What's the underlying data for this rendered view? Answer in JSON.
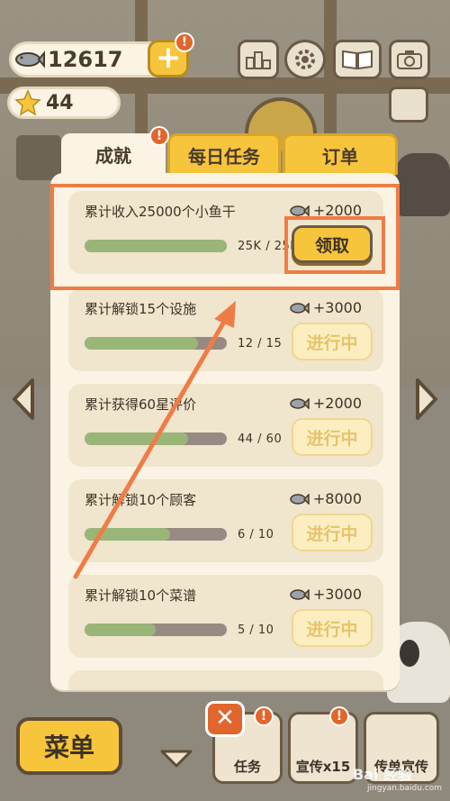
{
  "hud": {
    "fish_count": "12617",
    "star_count": "44",
    "badge_mark": "!"
  },
  "tabs": [
    {
      "label": "成就",
      "active": true
    },
    {
      "label": "每日任务",
      "active": false
    },
    {
      "label": "订单",
      "active": false
    }
  ],
  "achievements": [
    {
      "title": "累计收入25000个小鱼干",
      "reward": "+2000",
      "progress_text": "25K / 25K",
      "progress": 1.0,
      "button": "领取",
      "state": "claim"
    },
    {
      "title": "累计解锁15个设施",
      "reward": "+3000",
      "progress_text": "12  /  15",
      "progress": 0.8,
      "button": "进行中",
      "state": "in-progress"
    },
    {
      "title": "累计获得60星评价",
      "reward": "+2000",
      "progress_text": "44  /  60",
      "progress": 0.73,
      "button": "进行中",
      "state": "in-progress"
    },
    {
      "title": "累计解锁10个顾客",
      "reward": "+8000",
      "progress_text": "6  /  10",
      "progress": 0.6,
      "button": "进行中",
      "state": "in-progress"
    },
    {
      "title": "累计解锁10个菜谱",
      "reward": "+3000",
      "progress_text": "5  /  10",
      "progress": 0.5,
      "button": "进行中",
      "state": "in-progress"
    }
  ],
  "bottom": {
    "menu_label": "菜单",
    "task_label": "任务",
    "promo_label": "宣传x15",
    "flyer_label": "传单宣传",
    "close_mark": "✕"
  },
  "watermark": {
    "brand": "Bai 经验",
    "url": "jingyan.baidu.com"
  },
  "colors": {
    "accent_yellow": "#f7c53c",
    "highlight_orange": "#f07c45",
    "progress_green": "#99b678"
  }
}
